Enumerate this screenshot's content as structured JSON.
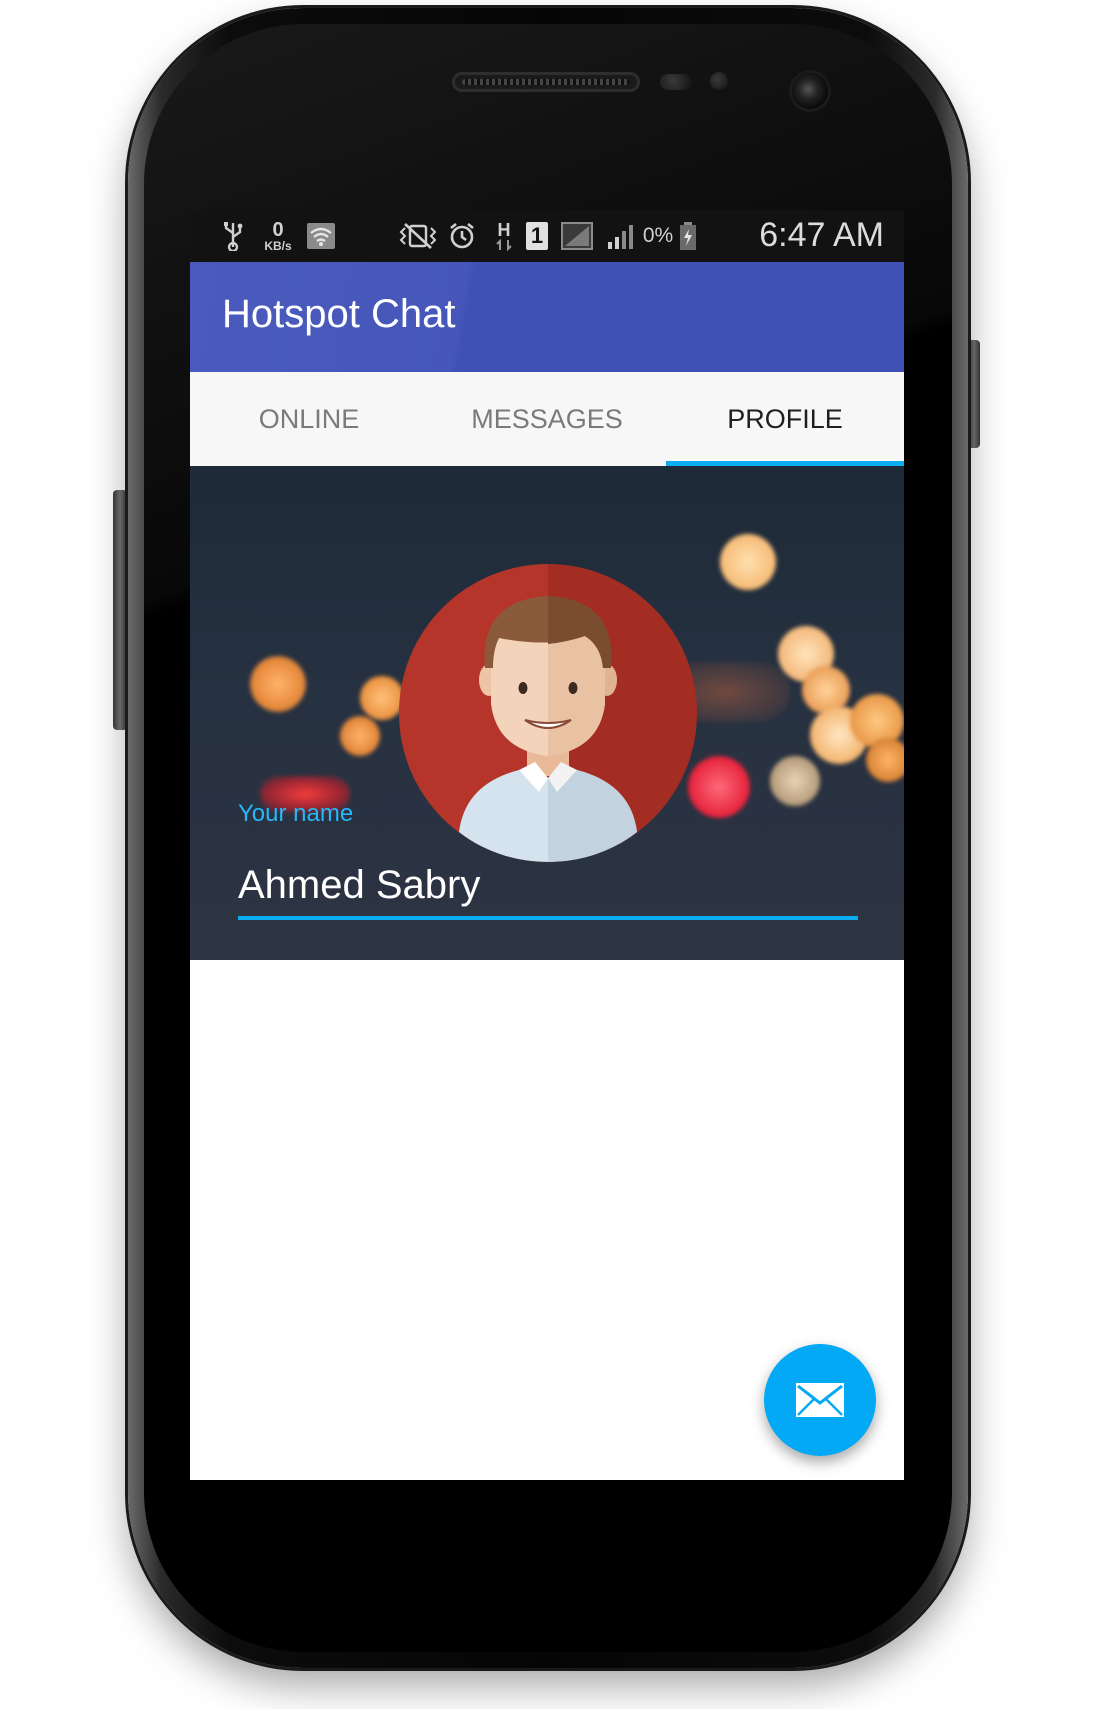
{
  "status_bar": {
    "net_speed_value": "0",
    "net_speed_unit": "KB/s",
    "network_type": "H",
    "sim_slot": "1",
    "battery_percent": "0%",
    "time": "6:47 AM",
    "icons": [
      "usb-icon",
      "wifi-icon",
      "vibrate-mute-icon",
      "alarm-icon",
      "data-arrows-icon",
      "sim-icon",
      "signal-icon",
      "signal-icon",
      "battery-icon"
    ]
  },
  "app_bar": {
    "title": "Hotspot Chat",
    "color": "#3f51b5"
  },
  "tabs": [
    {
      "label": "ONLINE",
      "active": false
    },
    {
      "label": "MESSAGES",
      "active": false
    },
    {
      "label": "PROFILE",
      "active": true
    }
  ],
  "profile": {
    "name_label": "Your name",
    "name_value": "Ahmed Sabry",
    "avatar": "male-user-avatar",
    "accent_color": "#0aaef0"
  },
  "fab": {
    "icon": "envelope-icon",
    "color": "#03a9f4"
  }
}
